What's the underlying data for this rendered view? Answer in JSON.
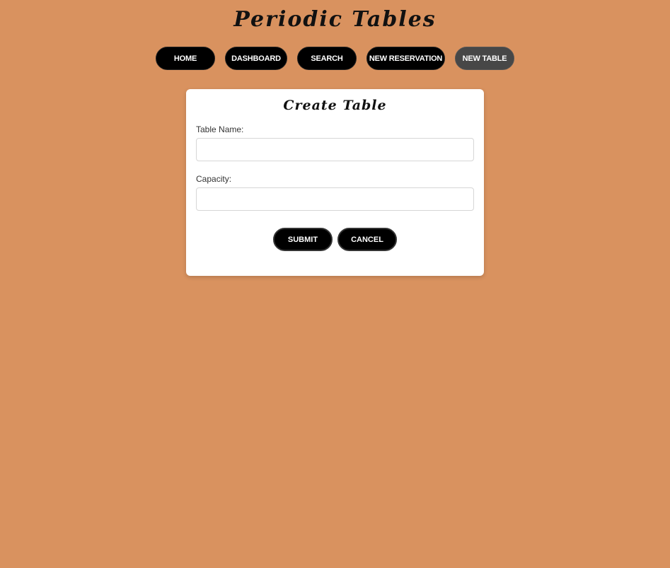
{
  "app": {
    "title": "Periodic Tables"
  },
  "nav": {
    "items": [
      {
        "label": "Home",
        "active": false
      },
      {
        "label": "Dashboard",
        "active": false
      },
      {
        "label": "Search",
        "active": false
      },
      {
        "label": "New Reservation",
        "active": false
      },
      {
        "label": "New Table",
        "active": true
      }
    ]
  },
  "form": {
    "title": "Create Table",
    "table_name": {
      "label": "Table Name:",
      "value": "",
      "placeholder": ""
    },
    "capacity": {
      "label": "Capacity:",
      "value": "",
      "placeholder": ""
    },
    "submit_label": "Submit",
    "cancel_label": "Cancel"
  },
  "colors": {
    "background": "#d9925f",
    "button": "#000000",
    "button_active": "#474747",
    "card": "#ffffff"
  }
}
